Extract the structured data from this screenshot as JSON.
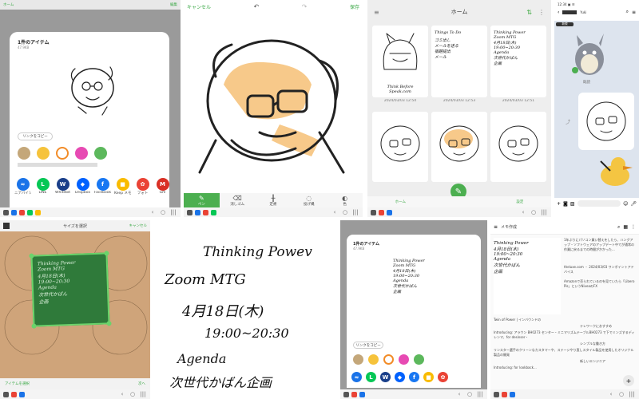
{
  "p1": {
    "header_left": "ホーム",
    "header_right": "編集",
    "sheet_title": "1件のアイテム",
    "sheet_size": "47.9KB",
    "link_label": "リンクをコピー",
    "apps": [
      {
        "label": "ニアバイシェア",
        "color": "#1a73e8",
        "glyph": "≈"
      },
      {
        "label": "LINE",
        "color": "#06c755",
        "glyph": "L"
      },
      {
        "label": "Whitebit",
        "color": "#1a3f8a",
        "glyph": "W"
      },
      {
        "label": "Dropbox",
        "color": "#0061fe",
        "glyph": "◆"
      },
      {
        "label": "Facebook",
        "color": "#1877f2",
        "glyph": "f"
      },
      {
        "label": "Keep メモ",
        "color": "#f9bb00",
        "glyph": "■"
      },
      {
        "label": "フォト",
        "color": "#ea4335",
        "glyph": "✿"
      },
      {
        "label": "Gm",
        "color": "#d93025",
        "glyph": "M"
      }
    ]
  },
  "p2": {
    "cancel": "キャンセル",
    "save": "保存",
    "tools": [
      "ペン",
      "消しゴム",
      "定規",
      "投げ縄",
      "色"
    ]
  },
  "p3": {
    "title": "ホーム",
    "dates": [
      "2024/03/03 12:54",
      "2024/03/03 12:53",
      "2024/03/03 12:51"
    ],
    "nav": [
      "ホーム",
      "",
      "設定"
    ],
    "card2": [
      "Things To Do",
      "ゴミ出し",
      "メールを送る",
      "宿題提出",
      "メール"
    ],
    "card3": [
      "Thinking Power",
      "Zoom MTG",
      "4月18日(木)",
      "19:00~20:30",
      "Agenda",
      "次世代かばん",
      "企画"
    ],
    "card1_caption": [
      "Think Before",
      "Speak.com"
    ]
  },
  "p4": {
    "chat_name": "Yuki",
    "badge_text": "新規",
    "read_label": "既読"
  },
  "p5": {
    "title": "サイズを選択",
    "right": "キャンセル",
    "note_lines": [
      "Thinking Power",
      "Zoom MTG",
      "4月18日(木)",
      "19:00~20:30",
      "Agenda",
      "次世代かばん",
      "企画"
    ],
    "bottom_left": "アイテムを選択",
    "bottom_right": "次へ"
  },
  "p6": {
    "lines": [
      "Thinking Powev",
      "Zoom MTG",
      "4月18日(木)",
      "19:00~20:30",
      "Agenda",
      "次世代かばん企画"
    ]
  },
  "p7": {
    "sheet_title": "1件のアイテム",
    "sheet_size": "47.9KB",
    "link_label": "リンクをコピー",
    "note_lines": [
      "Thinking Power",
      "Zoom MTG",
      "4月18日(木)",
      "19:00~20:30",
      "Agenda",
      "次世代かばん",
      "企画"
    ]
  },
  "p8": {
    "header": "メモ作成",
    "note_lines": [
      "Thinking Power",
      "4月18日(木)",
      "19:00~20:30",
      "Agenda",
      "次世代かばん",
      "企画"
    ],
    "feed": [
      {
        "text": "1年ぶりにパソコン買い替えをしたら、ハングアップ・ソフトウェアのアップデート中でが通常の作業に戻るまでの時間がかかった..."
      },
      {
        "text": "theluxe.com ・ 2024/03/03 ワンポイントアドバイス"
      },
      {
        "text": "Amazonで売られているのを見ていたら「Libero Pis」というNiveaのFX"
      },
      {
        "text": "Twin of Power | インバウンドの"
      },
      {
        "text": "Introducing: アラウン BH0273 センター・ミニマリズムテーブルBH0273 で下でミンズするディレンマ、for desinser・"
      },
      {
        "text": "リンスター選手のクリーンなカスタマーや、ステージやり直しスタイル製品を使用したオリジナル製品の開発"
      },
      {
        "text": "Introducing: for lookback..."
      }
    ],
    "feed_right": [
      "テレワークにおすすめ",
      "シンプルな働き方",
      "新しいエンジニア"
    ]
  }
}
